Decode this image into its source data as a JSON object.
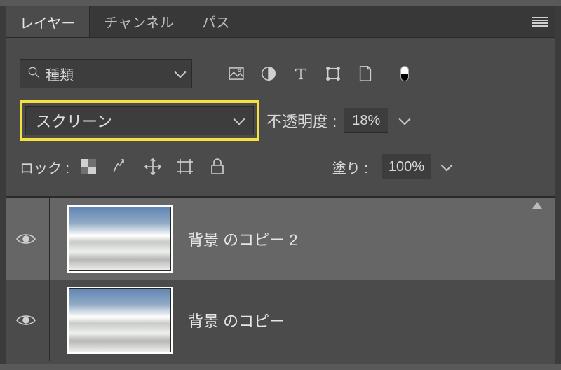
{
  "tabs": {
    "layers": "レイヤー",
    "channels": "チャンネル",
    "paths": "パス"
  },
  "filter": {
    "label": "種類"
  },
  "blend": {
    "mode": "スクリーン",
    "opacity_label": "不透明度 :",
    "opacity_value": "18%"
  },
  "lock": {
    "label": "ロック :"
  },
  "fill": {
    "label": "塗り :",
    "value": "100%"
  },
  "layers_list": [
    {
      "name": "背景 のコピー 2"
    },
    {
      "name": "背景 のコピー"
    }
  ],
  "icons": {
    "image": "image-icon",
    "adjust": "adjustment-icon",
    "type": "type-icon",
    "shape": "shape-icon",
    "smart": "smartobject-icon",
    "toggle": "filter-toggle"
  }
}
